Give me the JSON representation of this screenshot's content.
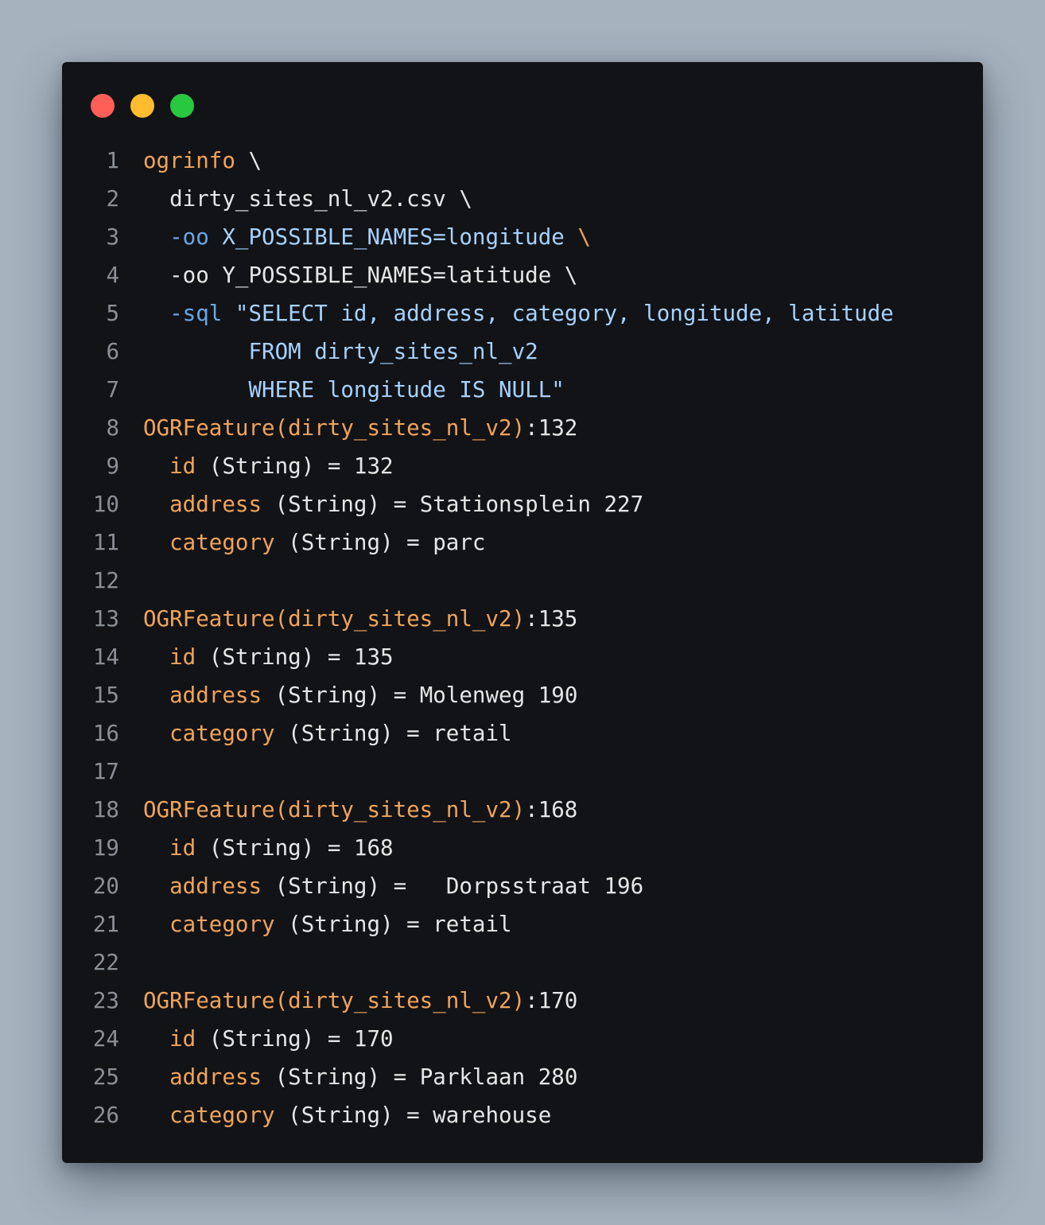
{
  "window": {
    "controls": [
      {
        "name": "close",
        "color": "#ff5f57"
      },
      {
        "name": "minimize",
        "color": "#febc2e"
      },
      {
        "name": "maximize",
        "color": "#28c840"
      }
    ]
  },
  "colors": {
    "background": "#a7b2bf",
    "panel": "#121316",
    "line_number": "#8b8f96",
    "text": "#e6e6e6",
    "keyword": "#f0a45b",
    "flag": "#6aa6e6",
    "string": "#a6d1ff"
  },
  "lines": [
    {
      "n": "1",
      "tokens": [
        {
          "t": "ogrinfo",
          "c": "keyword"
        },
        {
          "t": " \\",
          "c": "text"
        }
      ]
    },
    {
      "n": "2",
      "tokens": [
        {
          "t": "  dirty_sites_nl_v2.csv \\",
          "c": "text"
        }
      ]
    },
    {
      "n": "3",
      "tokens": [
        {
          "t": "  ",
          "c": "text"
        },
        {
          "t": "-oo",
          "c": "flag"
        },
        {
          "t": " X_POSSIBLE_NAMES=longitude",
          "c": "string"
        },
        {
          "t": " \\",
          "c": "keyword"
        }
      ]
    },
    {
      "n": "4",
      "tokens": [
        {
          "t": "  -oo Y_POSSIBLE_NAMES=latitude \\",
          "c": "text"
        }
      ]
    },
    {
      "n": "5",
      "tokens": [
        {
          "t": "  ",
          "c": "text"
        },
        {
          "t": "-sql",
          "c": "flag"
        },
        {
          "t": " \"SELECT id, address, category, longitude, latitude",
          "c": "string"
        }
      ]
    },
    {
      "n": "6",
      "tokens": [
        {
          "t": "        FROM dirty_sites_nl_v2",
          "c": "string"
        }
      ]
    },
    {
      "n": "7",
      "tokens": [
        {
          "t": "        WHERE longitude IS NULL\"",
          "c": "string"
        }
      ]
    },
    {
      "n": "8",
      "tokens": [
        {
          "t": "OGRFeature(dirty_sites_nl_v2)",
          "c": "keyword"
        },
        {
          "t": ":132",
          "c": "text"
        }
      ]
    },
    {
      "n": "9",
      "tokens": [
        {
          "t": "  ",
          "c": "text"
        },
        {
          "t": "id",
          "c": "keyword"
        },
        {
          "t": " (String) = 132",
          "c": "text"
        }
      ]
    },
    {
      "n": "10",
      "tokens": [
        {
          "t": "  ",
          "c": "text"
        },
        {
          "t": "address",
          "c": "keyword"
        },
        {
          "t": " (String) = Stationsplein 227",
          "c": "text"
        }
      ]
    },
    {
      "n": "11",
      "tokens": [
        {
          "t": "  ",
          "c": "text"
        },
        {
          "t": "category",
          "c": "keyword"
        },
        {
          "t": " (String) = parc",
          "c": "text"
        }
      ]
    },
    {
      "n": "12",
      "tokens": []
    },
    {
      "n": "13",
      "tokens": [
        {
          "t": "OGRFeature(dirty_sites_nl_v2)",
          "c": "keyword"
        },
        {
          "t": ":135",
          "c": "text"
        }
      ]
    },
    {
      "n": "14",
      "tokens": [
        {
          "t": "  ",
          "c": "text"
        },
        {
          "t": "id",
          "c": "keyword"
        },
        {
          "t": " (String) = 135",
          "c": "text"
        }
      ]
    },
    {
      "n": "15",
      "tokens": [
        {
          "t": "  ",
          "c": "text"
        },
        {
          "t": "address",
          "c": "keyword"
        },
        {
          "t": " (String) = Molenweg 190",
          "c": "text"
        }
      ]
    },
    {
      "n": "16",
      "tokens": [
        {
          "t": "  ",
          "c": "text"
        },
        {
          "t": "category",
          "c": "keyword"
        },
        {
          "t": " (String) = retail",
          "c": "text"
        }
      ]
    },
    {
      "n": "17",
      "tokens": []
    },
    {
      "n": "18",
      "tokens": [
        {
          "t": "OGRFeature(dirty_sites_nl_v2)",
          "c": "keyword"
        },
        {
          "t": ":168",
          "c": "text"
        }
      ]
    },
    {
      "n": "19",
      "tokens": [
        {
          "t": "  ",
          "c": "text"
        },
        {
          "t": "id",
          "c": "keyword"
        },
        {
          "t": " (String) = 168",
          "c": "text"
        }
      ]
    },
    {
      "n": "20",
      "tokens": [
        {
          "t": "  ",
          "c": "text"
        },
        {
          "t": "address",
          "c": "keyword"
        },
        {
          "t": " (String) =   Dorpsstraat 196",
          "c": "text"
        }
      ]
    },
    {
      "n": "21",
      "tokens": [
        {
          "t": "  ",
          "c": "text"
        },
        {
          "t": "category",
          "c": "keyword"
        },
        {
          "t": " (String) = retail",
          "c": "text"
        }
      ]
    },
    {
      "n": "22",
      "tokens": []
    },
    {
      "n": "23",
      "tokens": [
        {
          "t": "OGRFeature(dirty_sites_nl_v2)",
          "c": "keyword"
        },
        {
          "t": ":170",
          "c": "text"
        }
      ]
    },
    {
      "n": "24",
      "tokens": [
        {
          "t": "  ",
          "c": "text"
        },
        {
          "t": "id",
          "c": "keyword"
        },
        {
          "t": " (String) = 170",
          "c": "text"
        }
      ]
    },
    {
      "n": "25",
      "tokens": [
        {
          "t": "  ",
          "c": "text"
        },
        {
          "t": "address",
          "c": "keyword"
        },
        {
          "t": " (String) = Parklaan 280",
          "c": "text"
        }
      ]
    },
    {
      "n": "26",
      "tokens": [
        {
          "t": "  ",
          "c": "text"
        },
        {
          "t": "category",
          "c": "keyword"
        },
        {
          "t": " (String) = warehouse",
          "c": "text"
        }
      ]
    }
  ]
}
